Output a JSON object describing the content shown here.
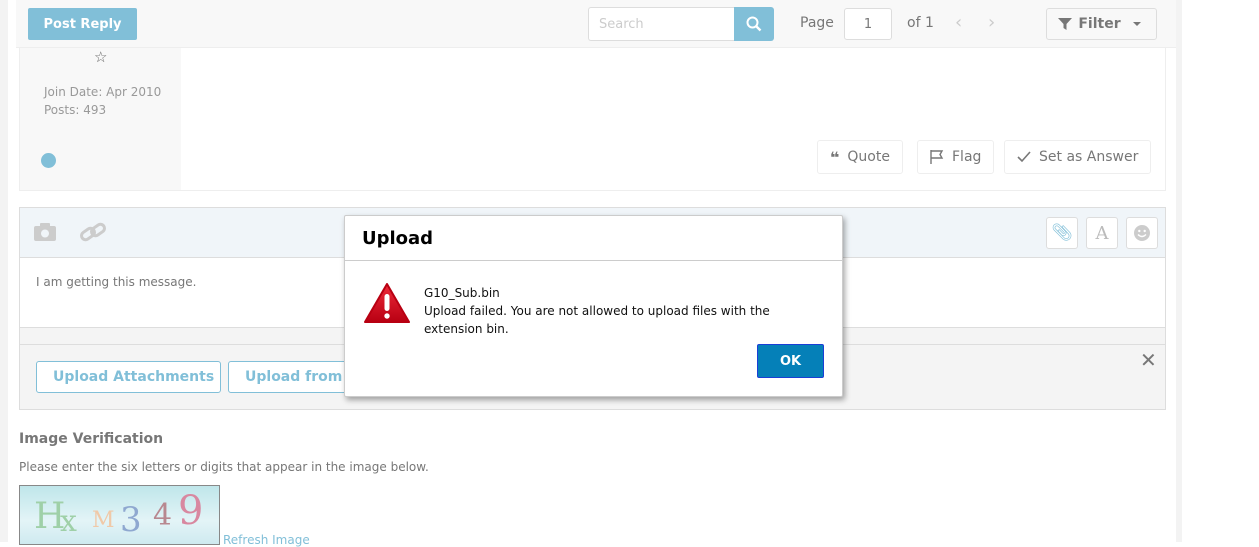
{
  "toolbar": {
    "post_reply": "Post Reply",
    "search_placeholder": "Search",
    "page_label": "Page",
    "page_value": "1",
    "page_of": "of 1",
    "filter": "Filter"
  },
  "post": {
    "join_date": "Join Date: Apr 2010",
    "posts": "Posts: 493",
    "quote": "Quote",
    "flag": "Flag",
    "set_answer": "Set as Answer"
  },
  "editor": {
    "text": "I am getting this message.",
    "upload_attachments": "Upload Attachments",
    "upload_from_url": "Upload from URL"
  },
  "verification": {
    "title": "Image Verification",
    "description": "Please enter the six letters or digits that appear in the image below.",
    "captcha": "Hx M 3 4 9",
    "refresh": "Refresh Image"
  },
  "dialog": {
    "title": "Upload",
    "filename": "G10_Sub.bin",
    "message": "Upload failed. You are not allowed to upload files with the extension bin.",
    "ok": "OK"
  },
  "colors": {
    "accent": "#81bfd8",
    "ok_button": "#0580b8",
    "warning": "#d0021b"
  }
}
